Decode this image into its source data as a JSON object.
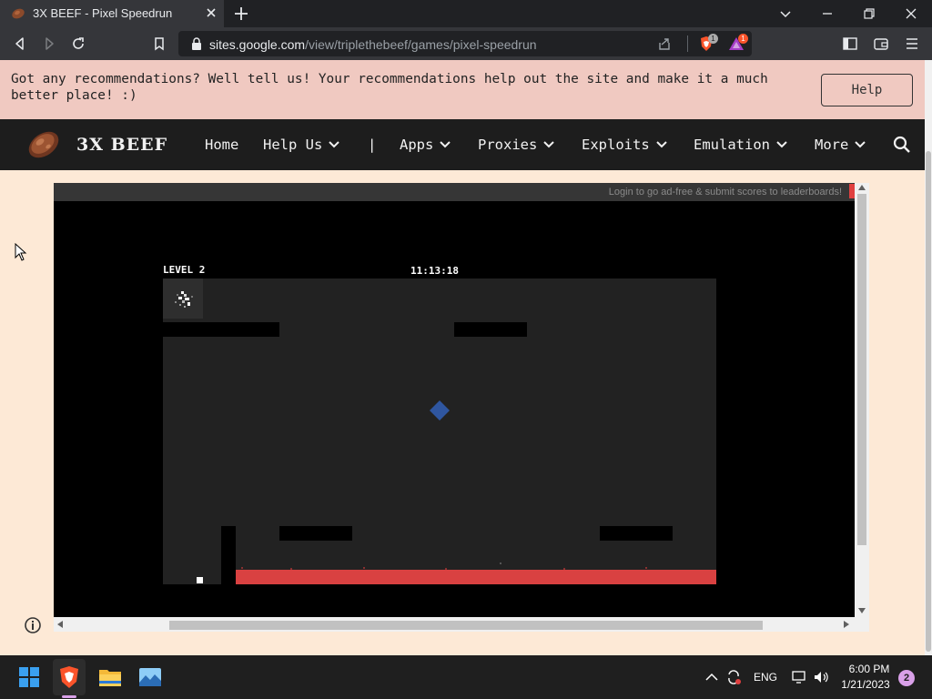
{
  "browser": {
    "tab_title": "3X BEEF - Pixel Speedrun",
    "url_host": "sites.google.com",
    "url_path": "/view/triplethebeef/games/pixel-speedrun",
    "brave_shield_count": "1",
    "rewards_count": "1"
  },
  "banner": {
    "message": "Got any recommendations? Well tell us! Your recommendations help out the site and make it a much better place! :)",
    "help_label": "Help"
  },
  "nav": {
    "brand": "3X BEEF",
    "items": [
      {
        "label": "Home",
        "dropdown": false
      },
      {
        "label": "Help Us",
        "dropdown": true
      },
      {
        "label": "|",
        "dropdown": false
      },
      {
        "label": "Apps",
        "dropdown": true
      },
      {
        "label": "Proxies",
        "dropdown": true
      },
      {
        "label": "Exploits",
        "dropdown": true
      },
      {
        "label": "Emulation",
        "dropdown": true
      },
      {
        "label": "More",
        "dropdown": true
      }
    ]
  },
  "game": {
    "login_text": "Login to go ad-free & submit scores to leaderboards!",
    "level_label": "LEVEL 2",
    "timer": "11:13:18"
  },
  "taskbar": {
    "language": "ENG",
    "time": "6:00 PM",
    "date": "1/21/2023",
    "notification_count": "2"
  },
  "colors": {
    "banner_bg": "#f0c9c1",
    "page_bg": "#fde9d6",
    "nav_bg": "#1d1d1d",
    "lava": "#d94141",
    "gem": "#2f56a0"
  }
}
